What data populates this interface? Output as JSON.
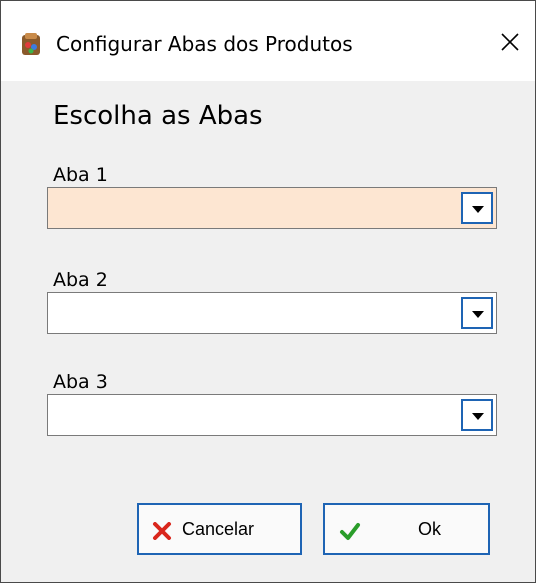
{
  "window": {
    "title": "Configurar Abas dos Produtos",
    "close_glyph": "✕"
  },
  "form": {
    "heading": "Escolha as Abas",
    "fields": [
      {
        "label": "Aba 1",
        "value": ""
      },
      {
        "label": "Aba 2",
        "value": ""
      },
      {
        "label": "Aba 3",
        "value": ""
      }
    ]
  },
  "buttons": {
    "cancel_label": "Cancelar",
    "ok_label": "Ok"
  },
  "colors": {
    "active_field_bg": "#fde6d2",
    "button_border": "#1e64b4",
    "cancel_icon": "#d9261c",
    "ok_icon": "#2a9d2a"
  },
  "icons": [
    "app-icon",
    "close-icon",
    "chevron-down-icon",
    "x-mark-icon",
    "checkmark-icon"
  ]
}
